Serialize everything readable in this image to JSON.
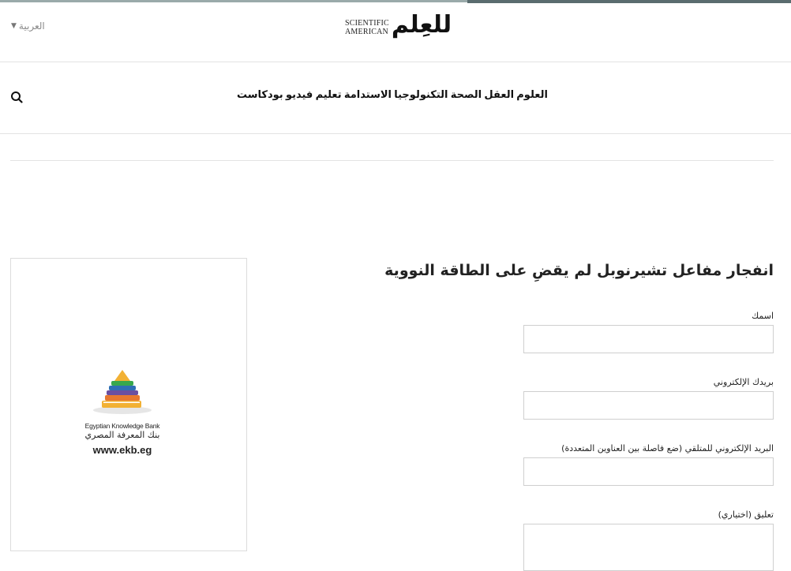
{
  "header": {
    "language": {
      "label": "العربية",
      "chevron_icon": "chevron-down-icon"
    },
    "logo": {
      "line1": "SCIENTIFIC",
      "line2": "AMERICAN",
      "arabic": "للعِلم"
    }
  },
  "nav": {
    "items": [
      {
        "label": "العلوم"
      },
      {
        "label": "العقل"
      },
      {
        "label": "الصحة"
      },
      {
        "label": "التكنولوجيا"
      },
      {
        "label": "الاستدامة"
      },
      {
        "label": "تعليم"
      },
      {
        "label": "فيديو"
      },
      {
        "label": "بودكاست"
      }
    ],
    "search_icon": "search-icon"
  },
  "ad": {
    "brand_en": "Egyptian Knowledge Bank",
    "brand_ar": "بنك المعرفة المصري",
    "url": "www.ekb.eg"
  },
  "form": {
    "title": "انفجار مفاعل تشيرنوبل لم يقضِ على الطاقة النووية",
    "fields": [
      {
        "label": "اسمك",
        "value": ""
      },
      {
        "label": "بريدك الإلكتروني",
        "value": ""
      },
      {
        "label": "البريد الإلكتروني للمتلقي (ضع فاصلة بين العناوين المتعددة)",
        "value": ""
      },
      {
        "label": "تعليق (اختياري)",
        "value": ""
      }
    ]
  },
  "colors": {
    "accent_bar": "#5a6c6f",
    "border": "#e3e3e3",
    "input_border": "#cfcfcf"
  }
}
